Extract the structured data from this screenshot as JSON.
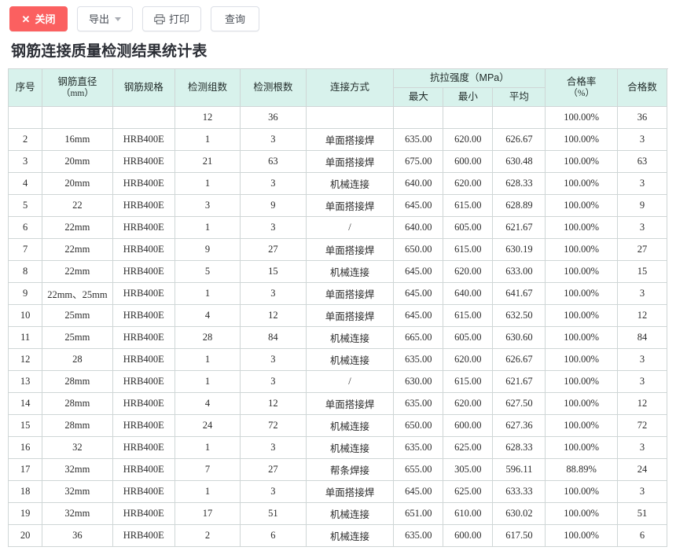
{
  "toolbar": {
    "close_label": "关闭",
    "close_icon": "close-x-icon",
    "close_color": "#fb6060",
    "export_label": "导出",
    "export_caret_icon": "chevron-down-icon",
    "print_label": "打印",
    "print_icon": "printer-icon",
    "query_label": "查询"
  },
  "page": {
    "title": "钢筋连接质量检测结果统计表"
  },
  "table": {
    "header_bg": "#d8f2ec",
    "border_color": "#cfd6d6",
    "groups": {
      "tensile_strength": "抗拉强度（MPa）"
    },
    "columns": {
      "seq": "序号",
      "diameter_line1": "钢筋直径",
      "diameter_line2": "（mm）",
      "spec": "钢筋规格",
      "group_count": "检测组数",
      "bar_count": "检测根数",
      "joint_type": "连接方式",
      "max": "最大",
      "min": "最小",
      "avg": "平均",
      "pass_rate_line1": "合格率",
      "pass_rate_line2": "（%）",
      "pass_count": "合格数"
    },
    "rows": [
      {
        "seq": "",
        "diameter": "",
        "spec": "",
        "group_count": "12",
        "bar_count": "36",
        "joint_type": "",
        "max": "",
        "min": "",
        "avg": "",
        "pass_rate": "100.00%",
        "pass_count": "36"
      },
      {
        "seq": "2",
        "diameter": "16mm",
        "spec": "HRB400E",
        "group_count": "1",
        "bar_count": "3",
        "joint_type": "单面搭接焊",
        "max": "635.00",
        "min": "620.00",
        "avg": "626.67",
        "pass_rate": "100.00%",
        "pass_count": "3"
      },
      {
        "seq": "3",
        "diameter": "20mm",
        "spec": "HRB400E",
        "group_count": "21",
        "bar_count": "63",
        "joint_type": "单面搭接焊",
        "max": "675.00",
        "min": "600.00",
        "avg": "630.48",
        "pass_rate": "100.00%",
        "pass_count": "63"
      },
      {
        "seq": "4",
        "diameter": "20mm",
        "spec": "HRB400E",
        "group_count": "1",
        "bar_count": "3",
        "joint_type": "机械连接",
        "max": "640.00",
        "min": "620.00",
        "avg": "628.33",
        "pass_rate": "100.00%",
        "pass_count": "3"
      },
      {
        "seq": "5",
        "diameter": "22",
        "spec": "HRB400E",
        "group_count": "3",
        "bar_count": "9",
        "joint_type": "单面搭接焊",
        "max": "645.00",
        "min": "615.00",
        "avg": "628.89",
        "pass_rate": "100.00%",
        "pass_count": "9"
      },
      {
        "seq": "6",
        "diameter": "22mm",
        "spec": "HRB400E",
        "group_count": "1",
        "bar_count": "3",
        "joint_type": "/",
        "max": "640.00",
        "min": "605.00",
        "avg": "621.67",
        "pass_rate": "100.00%",
        "pass_count": "3"
      },
      {
        "seq": "7",
        "diameter": "22mm",
        "spec": "HRB400E",
        "group_count": "9",
        "bar_count": "27",
        "joint_type": "单面搭接焊",
        "max": "650.00",
        "min": "615.00",
        "avg": "630.19",
        "pass_rate": "100.00%",
        "pass_count": "27"
      },
      {
        "seq": "8",
        "diameter": "22mm",
        "spec": "HRB400E",
        "group_count": "5",
        "bar_count": "15",
        "joint_type": "机械连接",
        "max": "645.00",
        "min": "620.00",
        "avg": "633.00",
        "pass_rate": "100.00%",
        "pass_count": "15"
      },
      {
        "seq": "9",
        "diameter": "22mm、25mm",
        "spec": "HRB400E",
        "group_count": "1",
        "bar_count": "3",
        "joint_type": "单面搭接焊",
        "max": "645.00",
        "min": "640.00",
        "avg": "641.67",
        "pass_rate": "100.00%",
        "pass_count": "3"
      },
      {
        "seq": "10",
        "diameter": "25mm",
        "spec": "HRB400E",
        "group_count": "4",
        "bar_count": "12",
        "joint_type": "单面搭接焊",
        "max": "645.00",
        "min": "615.00",
        "avg": "632.50",
        "pass_rate": "100.00%",
        "pass_count": "12"
      },
      {
        "seq": "11",
        "diameter": "25mm",
        "spec": "HRB400E",
        "group_count": "28",
        "bar_count": "84",
        "joint_type": "机械连接",
        "max": "665.00",
        "min": "605.00",
        "avg": "630.60",
        "pass_rate": "100.00%",
        "pass_count": "84"
      },
      {
        "seq": "12",
        "diameter": "28",
        "spec": "HRB400E",
        "group_count": "1",
        "bar_count": "3",
        "joint_type": "机械连接",
        "max": "635.00",
        "min": "620.00",
        "avg": "626.67",
        "pass_rate": "100.00%",
        "pass_count": "3"
      },
      {
        "seq": "13",
        "diameter": "28mm",
        "spec": "HRB400E",
        "group_count": "1",
        "bar_count": "3",
        "joint_type": "/",
        "max": "630.00",
        "min": "615.00",
        "avg": "621.67",
        "pass_rate": "100.00%",
        "pass_count": "3"
      },
      {
        "seq": "14",
        "diameter": "28mm",
        "spec": "HRB400E",
        "group_count": "4",
        "bar_count": "12",
        "joint_type": "单面搭接焊",
        "max": "635.00",
        "min": "620.00",
        "avg": "627.50",
        "pass_rate": "100.00%",
        "pass_count": "12"
      },
      {
        "seq": "15",
        "diameter": "28mm",
        "spec": "HRB400E",
        "group_count": "24",
        "bar_count": "72",
        "joint_type": "机械连接",
        "max": "650.00",
        "min": "600.00",
        "avg": "627.36",
        "pass_rate": "100.00%",
        "pass_count": "72"
      },
      {
        "seq": "16",
        "diameter": "32",
        "spec": "HRB400E",
        "group_count": "1",
        "bar_count": "3",
        "joint_type": "机械连接",
        "max": "635.00",
        "min": "625.00",
        "avg": "628.33",
        "pass_rate": "100.00%",
        "pass_count": "3"
      },
      {
        "seq": "17",
        "diameter": "32mm",
        "spec": "HRB400E",
        "group_count": "7",
        "bar_count": "27",
        "joint_type": "帮条焊接",
        "max": "655.00",
        "min": "305.00",
        "avg": "596.11",
        "pass_rate": "88.89%",
        "pass_count": "24"
      },
      {
        "seq": "18",
        "diameter": "32mm",
        "spec": "HRB400E",
        "group_count": "1",
        "bar_count": "3",
        "joint_type": "单面搭接焊",
        "max": "645.00",
        "min": "625.00",
        "avg": "633.33",
        "pass_rate": "100.00%",
        "pass_count": "3"
      },
      {
        "seq": "19",
        "diameter": "32mm",
        "spec": "HRB400E",
        "group_count": "17",
        "bar_count": "51",
        "joint_type": "机械连接",
        "max": "651.00",
        "min": "610.00",
        "avg": "630.02",
        "pass_rate": "100.00%",
        "pass_count": "51"
      },
      {
        "seq": "20",
        "diameter": "36",
        "spec": "HRB400E",
        "group_count": "2",
        "bar_count": "6",
        "joint_type": "机械连接",
        "max": "635.00",
        "min": "600.00",
        "avg": "617.50",
        "pass_rate": "100.00%",
        "pass_count": "6"
      }
    ]
  }
}
